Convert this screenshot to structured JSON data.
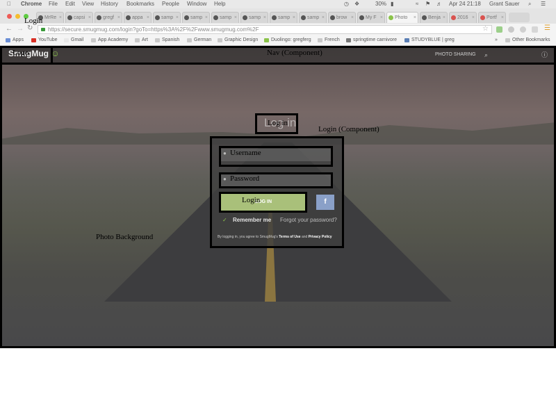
{
  "menubar": {
    "apple": "",
    "app": "Chrome",
    "items": [
      "File",
      "Edit",
      "View",
      "History",
      "Bookmarks",
      "People",
      "Window",
      "Help"
    ],
    "battery": "30%",
    "date": "Apr 24  21:18",
    "user": "Grant Sauer"
  },
  "tabs": [
    {
      "label": "MrRe"
    },
    {
      "label": "capsi"
    },
    {
      "label": "gregf"
    },
    {
      "label": "appa"
    },
    {
      "label": "samp"
    },
    {
      "label": "samp"
    },
    {
      "label": "samp"
    },
    {
      "label": "samp"
    },
    {
      "label": "samp"
    },
    {
      "label": "samp"
    },
    {
      "label": "brow"
    },
    {
      "label": "My F"
    },
    {
      "label": "Photo"
    },
    {
      "label": "Benja"
    },
    {
      "label": "2016"
    },
    {
      "label": "Portf"
    }
  ],
  "address": {
    "url": "https://secure.smugmug.com/login?goTo=https%3A%2F%2Fwww.smugmug.com%2F"
  },
  "bookmarks": [
    "Apps",
    "YouTube",
    "Gmail",
    "App Academy",
    "Art",
    "Spanish",
    "German",
    "Graphic Design",
    "Duolingo: gregferg",
    "French",
    "springtime carnivore",
    "STUDYBLUE | greg"
  ],
  "bookmarks_more": "»",
  "other_bookmarks": "Other Bookmarks",
  "site": {
    "logo": "SmugMug",
    "nav_link": "PHOTO SHARING",
    "login_heading": "Log in",
    "login_button": "LOG IN",
    "facebook": "f",
    "remember": "Remember me",
    "forgot": "Forgot your password?",
    "terms_prefix": "By logging in, you agree to SmugMug's",
    "terms_link": "Terms of Use",
    "terms_and": "and",
    "privacy_link": "Privacy Policy"
  },
  "annotations": {
    "page": "Login",
    "logo": "Logo",
    "nav": "Nav (Component)",
    "login_title": "Log in",
    "login_component": "Login (Component)",
    "username": "Username",
    "password": "Password",
    "login_btn": "Login",
    "photo_bg": "Photo Background"
  }
}
